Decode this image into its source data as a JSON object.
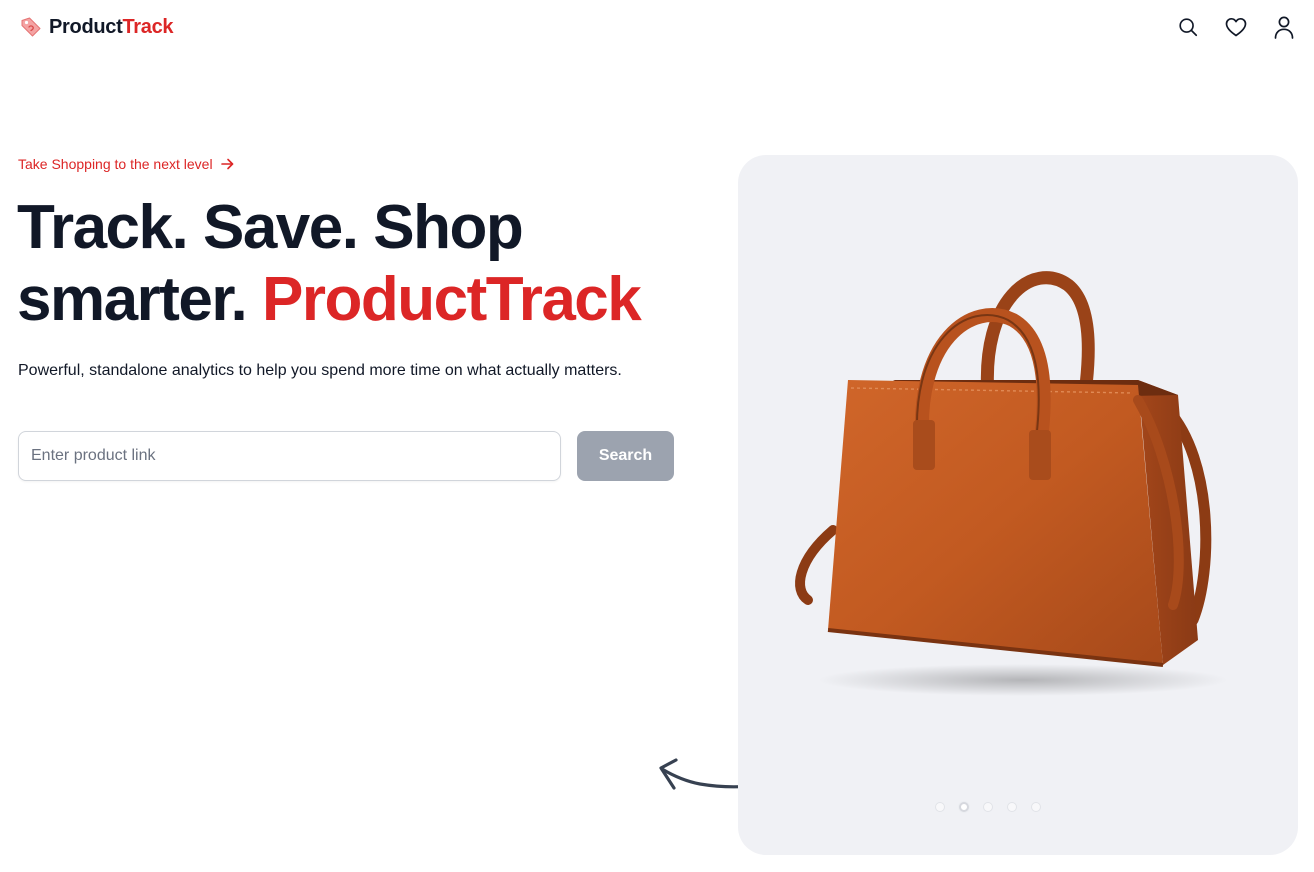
{
  "header": {
    "brand_dark": "Product",
    "brand_red": "Track",
    "icons": [
      "search-icon",
      "heart-icon",
      "user-icon"
    ]
  },
  "hero": {
    "tagline": "Take Shopping to the next level",
    "headline_line1": "Track. Save. Shop",
    "headline_line2_dark": "smarter.",
    "headline_line2_red": "ProductTrack",
    "subtext": "Powerful, standalone analytics to help you spend more time on what actually matters.",
    "search": {
      "placeholder": "Enter product link",
      "value": "",
      "button_label": "Search"
    }
  },
  "carousel": {
    "slide_count": 5,
    "active_index": 1,
    "image": "brown-leather-handbag"
  },
  "colors": {
    "accent": "#dc2626",
    "text": "#111827",
    "button_disabled": "#9ca3af",
    "panel": "#f0f1f5"
  }
}
